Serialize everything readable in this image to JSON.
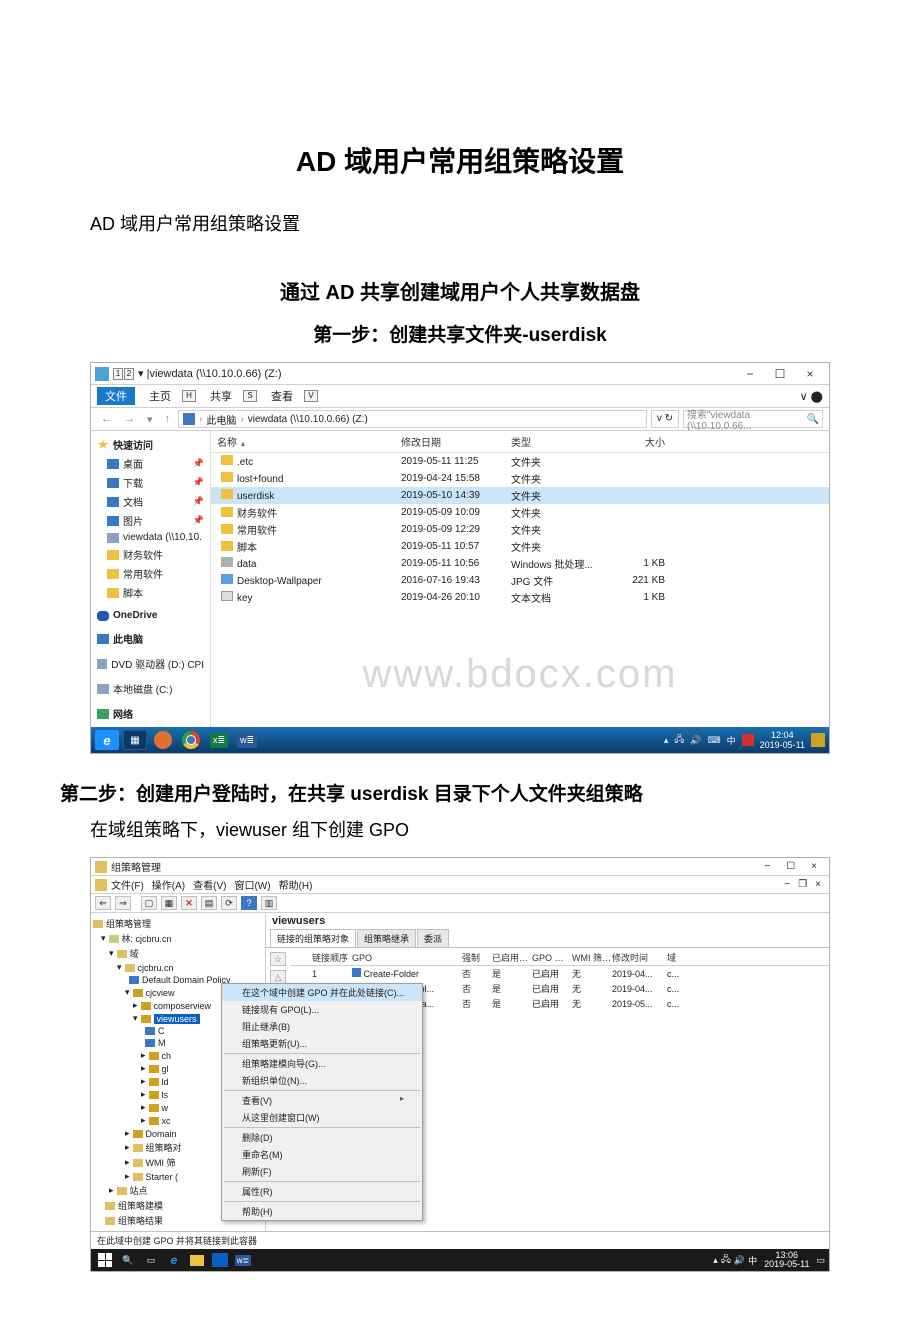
{
  "doc": {
    "title": "AD 域用户常用组策略设置",
    "intro": "AD 域用户常用组策略设置",
    "section1": "通过 AD 共享创建域用户个人共享数据盘",
    "step1": "第一步：创建共享文件夹-userdisk",
    "step2": "第二步：创建用户登陆时，在共享 userdisk 目录下个人文件夹组策略",
    "body1": "在域组策略下，viewuser 组下创建 GPO"
  },
  "explorer": {
    "title": "viewdata (\\\\10.10.0.66) (Z:)",
    "tabs": {
      "file": "文件",
      "home": "主页",
      "share": "共享",
      "view": "查看"
    },
    "keys": {
      "one": "1",
      "two": "2",
      "h": "H",
      "s": "S",
      "v": "V"
    },
    "crumbs": {
      "pc": "此电脑",
      "drive": "viewdata (\\\\10.10.0.66) (Z:)"
    },
    "refresh_hint": "v  ↻",
    "search_placeholder": "搜索\"viewdata (\\\\10.10.0.66...",
    "columns": {
      "name": "名称",
      "date": "修改日期",
      "type": "类型",
      "size": "大小"
    },
    "sidebar": {
      "quick": "快速访问",
      "desktop": "桌面",
      "downloads": "下载",
      "documents": "文档",
      "pictures": "图片",
      "viewdata": "viewdata (\\\\10.10.",
      "fin": "财务软件",
      "common": "常用软件",
      "scripts": "脚本",
      "onedrive": "OneDrive",
      "thispc": "此电脑",
      "dvd": "DVD 驱动器 (D:) CPI",
      "localc": "本地磁盘 (C:)",
      "network": "网络"
    },
    "files": [
      {
        "name": ".etc",
        "date": "2019-05-11 11:25",
        "type": "文件夹",
        "size": ""
      },
      {
        "name": "lost+found",
        "date": "2019-04-24 15:58",
        "type": "文件夹",
        "size": ""
      },
      {
        "name": "userdisk",
        "date": "2019-05-10 14:39",
        "type": "文件夹",
        "size": "",
        "selected": true
      },
      {
        "name": "财务软件",
        "date": "2019-05-09 10:09",
        "type": "文件夹",
        "size": ""
      },
      {
        "name": "常用软件",
        "date": "2019-05-09 12:29",
        "type": "文件夹",
        "size": ""
      },
      {
        "name": "脚本",
        "date": "2019-05-11 10:57",
        "type": "文件夹",
        "size": ""
      },
      {
        "name": "data",
        "date": "2019-05-11 10:56",
        "type": "Windows 批处理...",
        "size": "1 KB",
        "icon": "bat"
      },
      {
        "name": "Desktop-Wallpaper",
        "date": "2016-07-16 19:43",
        "type": "JPG 文件",
        "size": "221 KB",
        "icon": "img"
      },
      {
        "name": "key",
        "date": "2019-04-26 20:10",
        "type": "文本文档",
        "size": "1 KB",
        "icon": "txt"
      }
    ],
    "watermark": "www.bdocx.com",
    "tray": {
      "ime": "中",
      "time": "12:04",
      "date": "2019-05-11"
    }
  },
  "gpmc": {
    "title": "组策略管理",
    "menu": {
      "file": "文件(F)",
      "action": "操作(A)",
      "view": "查看(V)",
      "window": "窗口(W)",
      "help": "帮助(H)"
    },
    "winctl": {
      "min": "−",
      "max": "☐",
      "close": "×",
      "restore": "❐"
    },
    "tree": {
      "root": "组策略管理",
      "forest": "林: cjcbru.cn",
      "domains": "域",
      "domain": "cjcbru.cn",
      "default": "Default Domain Policy",
      "cjcview": "cjcview",
      "composerview": "composerview",
      "viewusers": "viewusers",
      "c": "C",
      "m": "M",
      "ch": "ch",
      "gl": "gl",
      "ld": "ld",
      "ls": "ls",
      "w": "w",
      "xc": "xc",
      "domain_controllers": "Domain",
      "gpo_container": "组策略对",
      "wmi": "WMI 筛",
      "starter": "Starter (",
      "sites": "站点",
      "modeling": "组策略建模",
      "results": "组策略结果"
    },
    "context": {
      "create_link": "在这个域中创建 GPO 并在此处链接(C)...",
      "link_existing": "链接现有 GPO(L)...",
      "block_inherit": "阻止继承(B)",
      "gp_update": "组策略更新(U)...",
      "gp_modeling": "组策略建模向导(G)...",
      "new_ou": "新组织单位(N)...",
      "view": "查看(V)",
      "new_window": "从这里创建窗口(W)",
      "delete": "删除(D)",
      "rename": "重命名(M)",
      "refresh": "刷新(F)",
      "properties": "属性(R)",
      "help": "帮助(H)"
    },
    "main": {
      "object": "viewusers",
      "tabs": {
        "linked": "链接的组策略对象",
        "inheritance": "组策略继承",
        "delegation": "委派"
      },
      "columns": {
        "order": "链接顺序",
        "gpo": "GPO",
        "enforced": "强制",
        "link": "已启用链接",
        "status": "GPO 状态",
        "wmi": "WMI 筛选器",
        "modified": "修改时间",
        "dom": "域"
      },
      "rows": [
        {
          "order": "1",
          "gpo": "Create-Folder",
          "enforced": "否",
          "link": "是",
          "status": "已启用",
          "wmi": "无",
          "modified": "2019-04...",
          "dom": "c..."
        },
        {
          "order": "2",
          "gpo": "Mount-User-Pol...",
          "enforced": "否",
          "link": "是",
          "status": "已启用",
          "wmi": "无",
          "modified": "2019-04...",
          "dom": "c..."
        },
        {
          "order": "3",
          "gpo": "Desktop-Wallpa...",
          "enforced": "否",
          "link": "是",
          "status": "已启用",
          "wmi": "无",
          "modified": "2019-05...",
          "dom": "c..."
        }
      ],
      "side": {
        "top": "☆",
        "up": "△",
        "down": "▽"
      }
    },
    "status": "在此域中创建 GPO 并将其链接到此容器",
    "tray": {
      "time": "13:06",
      "date": "2019-05-11"
    }
  }
}
